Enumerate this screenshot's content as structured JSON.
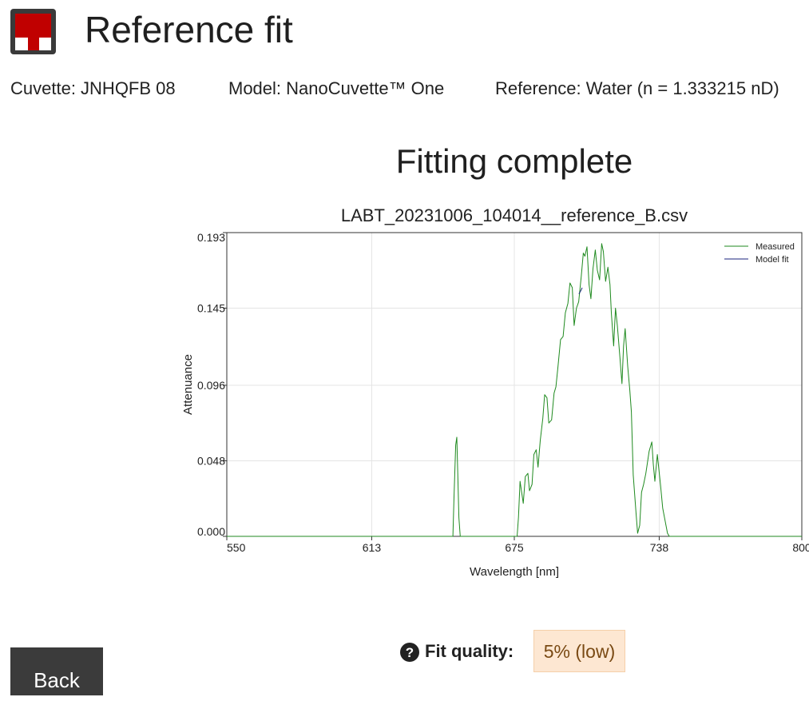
{
  "header": {
    "title": "Reference fit",
    "logo_icon": "app-logo-icon"
  },
  "info": {
    "cuvette": "Cuvette: JNHQFB 08",
    "model": "Model: NanoCuvette™ One",
    "reference": "Reference: Water (n = 1.333215 nD)"
  },
  "status": {
    "title": "Fitting complete"
  },
  "chart_data": {
    "type": "line",
    "title": "LABT_20231006_104014__reference_B.csv",
    "xlabel": "Wavelength [nm]",
    "ylabel": "Attenuance",
    "xlim": [
      550,
      800
    ],
    "ylim": [
      0,
      0.193
    ],
    "xticks": [
      "550",
      "613",
      "675",
      "738",
      "800"
    ],
    "yticks": [
      "0.000",
      "0.048",
      "0.096",
      "0.145",
      "0.193"
    ],
    "xtick_values": [
      550,
      613,
      675,
      738,
      800
    ],
    "ytick_values": [
      0,
      0.048,
      0.096,
      0.145,
      0.193
    ],
    "grid": true,
    "legend_position": "top-right",
    "series": [
      {
        "name": "Measured",
        "color": "#1f8a1f",
        "x": [
          550,
          648.3,
          648.8,
          649.5,
          650.0,
          650.4,
          650.9,
          651.5,
          652.0,
          651.9,
          652.5,
          653.5,
          676.2,
          676.8,
          677.5,
          678.2,
          678.9,
          679.8,
          680.9,
          681.6,
          682.7,
          683.5,
          684.5,
          685.3,
          686.3,
          687.4,
          688.2,
          689.2,
          690.0,
          691.2,
          692.3,
          693.1,
          694.0,
          695.1,
          696.2,
          697.2,
          698.3,
          699.2,
          700.2,
          701.0,
          702.0,
          703.0,
          704.1,
          705.0,
          705.7,
          706.6,
          707.5,
          708.3,
          709.2,
          710.2,
          711.1,
          712.1,
          713.0,
          713.7,
          714.7,
          715.7,
          716.6,
          717.2,
          718.2,
          719.0,
          719.8,
          720.9,
          721.8,
          722.5,
          723.2,
          724.3,
          725.2,
          725.9,
          726.7,
          727.9,
          728.6,
          729.5,
          730.3,
          731.2,
          732.2,
          733.6,
          734.8,
          735.4,
          736.1,
          737.2,
          738.6,
          739.5,
          740.4,
          741.6,
          742.4,
          743.3,
          744.0,
          800
        ],
        "y": [
          0,
          0,
          0.025,
          0.058,
          0.063,
          0.04,
          0.012,
          0,
          0,
          0,
          0,
          0,
          0,
          0.012,
          0.035,
          0.028,
          0.021,
          0.038,
          0.04,
          0.029,
          0.033,
          0.052,
          0.055,
          0.044,
          0.061,
          0.075,
          0.09,
          0.088,
          0.072,
          0.074,
          0.091,
          0.095,
          0.108,
          0.125,
          0.127,
          0.142,
          0.148,
          0.161,
          0.158,
          0.134,
          0.145,
          0.149,
          0.165,
          0.18,
          0.178,
          0.184,
          0.16,
          0.151,
          0.17,
          0.182,
          0.169,
          0.163,
          0.186,
          0.181,
          0.162,
          0.171,
          0.16,
          0.142,
          0.121,
          0.145,
          0.134,
          0.114,
          0.097,
          0.121,
          0.132,
          0.108,
          0.093,
          0.079,
          0.039,
          0.015,
          0.002,
          0.007,
          0.028,
          0.033,
          0.04,
          0.054,
          0.06,
          0.046,
          0.035,
          0.052,
          0.032,
          0.018,
          0.011,
          0.002,
          0,
          0,
          0,
          0
        ]
      },
      {
        "name": "Model fit",
        "color": "#1a237e",
        "x": [
          703.1,
          703.9,
          704.5
        ],
        "y": [
          0.154,
          0.156,
          0.158
        ]
      }
    ]
  },
  "fit_quality": {
    "label": "Fit quality:",
    "value": "5% (low)",
    "help_icon": "help-circle-icon"
  },
  "back_button": {
    "label": "Back"
  }
}
